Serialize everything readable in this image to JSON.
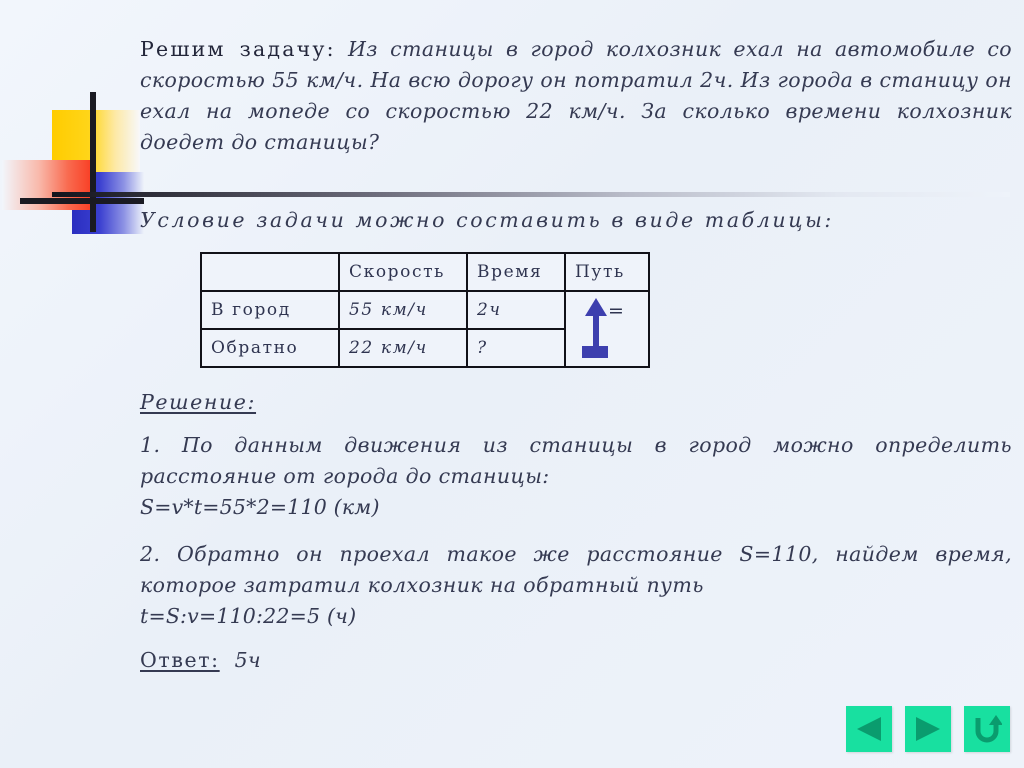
{
  "slide": {
    "background_color": "#eef3fa",
    "text_color": "#353a52"
  },
  "intro": {
    "label": "Решим задачу:",
    "text": "Из станицы в город колхозник ехал на автомобиле со скоростью 55 км/ч. На всю дорогу он потратил 2ч. Из города в станицу он ехал на мопеде со скоростью 22 км/ч. За сколько времени колхозник доедет до станицы?"
  },
  "table_intro": {
    "text": "Условие задачи можно составить в виде таблицы:"
  },
  "table": {
    "headers": [
      "",
      "Скорость",
      "Время",
      "Путь"
    ],
    "rows": [
      {
        "label": "В город",
        "speed": "55 км/ч",
        "time": "2ч",
        "path": "="
      },
      {
        "label": "Обратно",
        "speed": "22 км/ч",
        "time": "?",
        "path": ""
      }
    ]
  },
  "solution": {
    "label": "Решение:",
    "step1_text": "1. По данным движения из станицы в город можно определить расстояние от города до станицы:",
    "step1_formula": "S=v*t=55*2=110 (км)",
    "step2_text": "2. Обратно он проехал такое же расстояние S=110, найдем время, которое затратил колхозник на обратный путь",
    "step2_formula": "t=S:v=110:22=5 (ч)",
    "answer_label": "Ответ:",
    "answer_value": "5ч"
  },
  "nav": {
    "accent_color": "#18e0a0",
    "glyph_color": "#0a9c6e",
    "buttons": [
      {
        "name": "previous-slide-button",
        "icon": "triangle-left-icon"
      },
      {
        "name": "next-slide-button",
        "icon": "triangle-right-icon"
      },
      {
        "name": "return-button",
        "icon": "u-turn-arrow-icon"
      }
    ]
  },
  "decoration": {
    "colors": {
      "yellow": "#ffcc00",
      "blue": "#2a2ec0",
      "red": "#f93a20",
      "bar": "#1a1a22"
    }
  },
  "arrow_marker": {
    "color": "#3d3fae",
    "description": "up-arrow-equal-path-marker"
  }
}
